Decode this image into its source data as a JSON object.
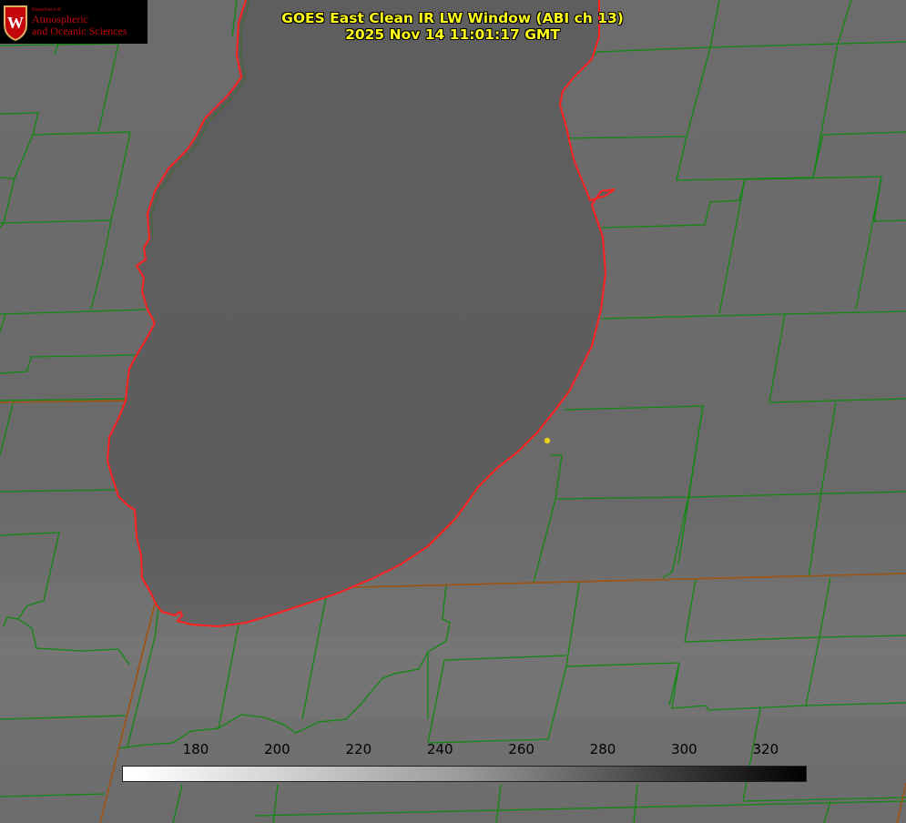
{
  "title": {
    "line1": "GOES East Clean IR LW Window (ABI ch 13)",
    "line2": "2025 Nov 14 11:01:17 GMT"
  },
  "logo": {
    "department": "Department of",
    "name_line1": "Atmospheric",
    "name_line2": "and Oceanic Sciences",
    "seal_letter": "W"
  },
  "colorbar": {
    "ticks": [
      "180",
      "200",
      "220",
      "240",
      "260",
      "280",
      "300",
      "320"
    ],
    "min_color": "#ffffff",
    "max_color": "#000000"
  },
  "colors": {
    "background": "#6e6e6e",
    "lake": "#5e5e5e",
    "county_lines": "#118811",
    "state_lines": "#a0520f",
    "coastline": "#ff2020",
    "marker": "#e8d020",
    "title": "#ffff1a"
  }
}
